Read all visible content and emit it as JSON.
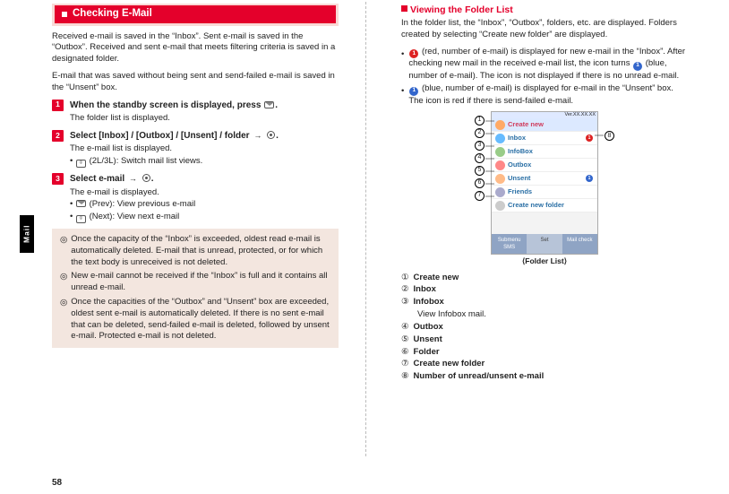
{
  "page_number": "58",
  "side_tab": "Mail",
  "left": {
    "header": "Checking E-Mail",
    "intro1": "Received e-mail is saved in the “Inbox”. Sent e-mail is saved in the “Outbox”. Received and sent e-mail that meets filtering criteria is saved in a designated folder.",
    "intro2": "E-mail that was saved without being sent and send-failed e-mail is saved in the “Unsent” box.",
    "step1": {
      "num": "1",
      "title_a": "When the standby screen is displayed, press ",
      "title_b": ".",
      "body": "The folder list is displayed."
    },
    "step2": {
      "num": "2",
      "title_a": "Select [Inbox] / [Outbox] / [Unsent] / folder ",
      "title_b": ".",
      "body": "The e-mail list is displayed.",
      "sub1_pre": "",
      "sub1_post": " (2L/3L): Switch mail list views."
    },
    "step3": {
      "num": "3",
      "title_a": "Select e-mail ",
      "title_b": ".",
      "body": "The e-mail is displayed.",
      "sub1_post": " (Prev): View previous e-mail",
      "sub2_post": " (Next): View next e-mail"
    },
    "note1": "Once the capacity of the “Inbox” is exceeded, oldest read e-mail is automatically deleted. E-mail that is unread, protected, or for which the text body is unreceived is not deleted.",
    "note2": "New e-mail cannot be received if the “Inbox” is full and it contains all unread e-mail.",
    "note3": "Once the capacities of the “Outbox” and “Unsent” box are exceeded, oldest sent e-mail is automatically deleted. If there is no sent e-mail that can be deleted, send-failed e-mail is deleted, followed by unsent e-mail. Protected e-mail is not deleted."
  },
  "right": {
    "section_title": "Viewing the Folder List",
    "intro1": "In the folder list, the “Inbox”, “Outbox”, folders, etc. are displayed. Folders created by selecting “Create new folder” are displayed.",
    "bul1_a": " (red, number of e-mail) is displayed for new e-mail in the “Inbox”. After checking new mail in the received e-mail list, the icon turns ",
    "bul1_b": " (blue, number of e-mail). The icon is not displayed if there is no unread e-mail.",
    "bul2": " (blue, number of e-mail) is displayed for e-mail in the “Unsent” box. The icon is red if there is send-failed e-mail.",
    "phone": {
      "ver": "Ver.XX.XX.XX",
      "rows": [
        "Create new",
        "Inbox",
        "InfoBox",
        "Outbox",
        "Unsent",
        "Friends",
        "Create new folder"
      ],
      "btn_a": "Submenu",
      "btn_a2": "SMS",
      "btn_b": "Set",
      "btn_c": "Mail check",
      "caption": "⟨Folder List⟩"
    },
    "legend": [
      {
        "n": "①",
        "label": "Create new",
        "sub": ""
      },
      {
        "n": "②",
        "label": "Inbox",
        "sub": ""
      },
      {
        "n": "③",
        "label": "Infobox",
        "sub": "View Infobox mail."
      },
      {
        "n": "④",
        "label": "Outbox",
        "sub": ""
      },
      {
        "n": "⑤",
        "label": "Unsent",
        "sub": ""
      },
      {
        "n": "⑥",
        "label": "Folder",
        "sub": ""
      },
      {
        "n": "⑦",
        "label": "Create new folder",
        "sub": ""
      },
      {
        "n": "⑧",
        "label": "Number of unread/unsent e-mail",
        "sub": ""
      }
    ]
  },
  "chart_data": {
    "type": "table",
    "title": "Folder List callouts",
    "rows": [
      {
        "num": 1,
        "item": "Create new"
      },
      {
        "num": 2,
        "item": "Inbox"
      },
      {
        "num": 3,
        "item": "Infobox",
        "note": "View Infobox mail."
      },
      {
        "num": 4,
        "item": "Outbox"
      },
      {
        "num": 5,
        "item": "Unsent"
      },
      {
        "num": 6,
        "item": "Folder"
      },
      {
        "num": 7,
        "item": "Create new folder"
      },
      {
        "num": 8,
        "item": "Number of unread/unsent e-mail"
      }
    ]
  }
}
